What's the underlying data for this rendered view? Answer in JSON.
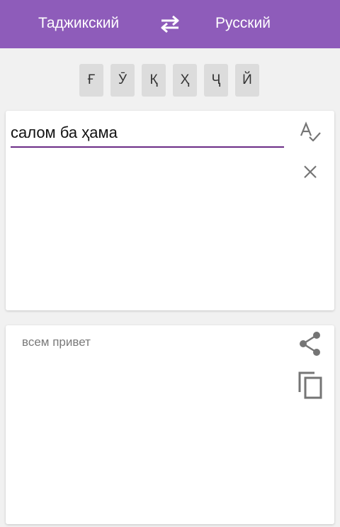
{
  "header": {
    "source_language": "Таджикский",
    "target_language": "Русский",
    "swap_icon": "swap-arrows-icon",
    "background_color": "#8e5cba"
  },
  "special_keys": [
    "Ғ",
    "Ӯ",
    "Қ",
    "Ҳ",
    "Ҷ",
    "Й"
  ],
  "input": {
    "text": "салом ба ҳама",
    "spellcheck_icon": "spellcheck-icon",
    "clear_icon": "close-icon",
    "underline_color": "#6b2d86"
  },
  "output": {
    "text": "всем привет",
    "share_icon": "share-icon",
    "copy_icon": "copy-icon"
  }
}
